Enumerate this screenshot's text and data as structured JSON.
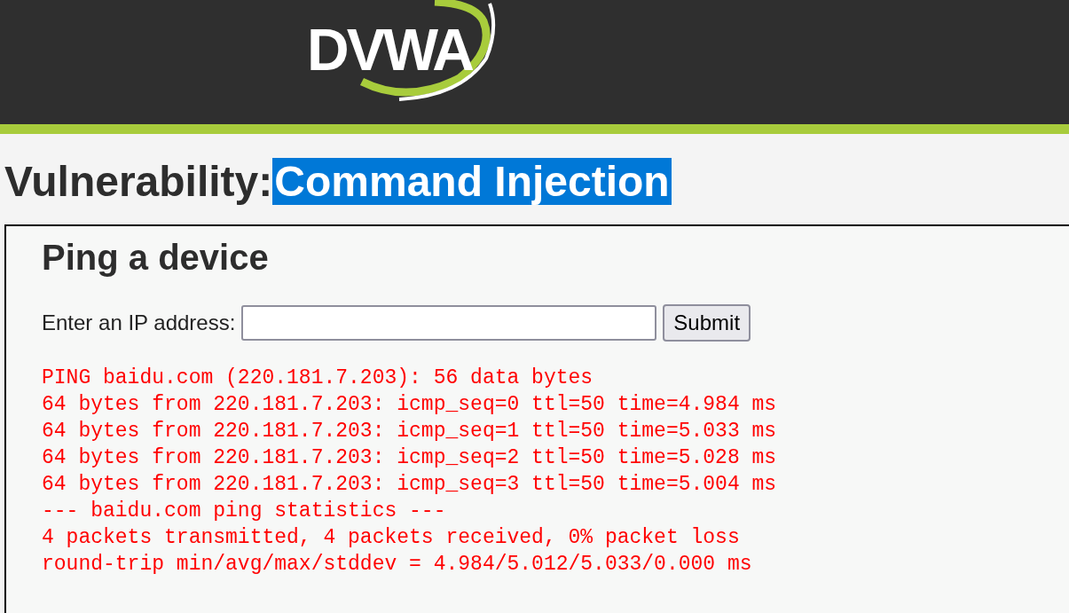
{
  "header": {
    "logo": "DVWA"
  },
  "title": {
    "prefix": "Vulnerability:",
    "highlighted": "Command Injection",
    "selected": true
  },
  "panel": {
    "heading": "Ping a device",
    "form": {
      "label": "Enter an IP address:",
      "button": "Submit"
    },
    "output": [
      "PING baidu.com (220.181.7.203): 56 data bytes",
      "64 bytes from 220.181.7.203: icmp_seq=0 ttl=50 time=4.984 ms",
      "64 bytes from 220.181.7.203: icmp_seq=1 ttl=50 time=5.033 ms",
      "64 bytes from 220.181.7.203: icmp_seq=2 ttl=50 time=5.028 ms",
      "64 bytes from 220.181.7.203: icmp_seq=3 ttl=50 time=5.004 ms",
      "--- baidu.com ping statistics ---",
      "4 packets transmitted, 4 packets received, 0% packet loss",
      "round-trip min/avg/max/stddev = 4.984/5.012/5.033/0.000 ms"
    ]
  }
}
